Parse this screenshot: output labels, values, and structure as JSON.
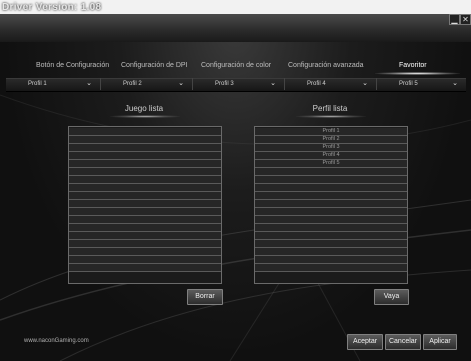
{
  "window": {
    "title": "Driver Version: 1.08"
  },
  "tabs": [
    {
      "label": "Botón de Configuración"
    },
    {
      "label": "Configuración de DPI"
    },
    {
      "label": "Configuración de color"
    },
    {
      "label": "Configuración avanzada"
    },
    {
      "label": "Favoritor"
    }
  ],
  "profiles": [
    {
      "label": "Profil 1"
    },
    {
      "label": "Profil 2"
    },
    {
      "label": "Profil 3"
    },
    {
      "label": "Profil 4"
    },
    {
      "label": "Profil 5"
    }
  ],
  "game_list": {
    "title": "Juego lista",
    "rows": [
      "",
      "",
      "",
      "",
      "",
      "",
      "",
      "",
      "",
      "",
      "",
      "",
      "",
      "",
      "",
      "",
      "",
      ""
    ],
    "button": "Borrar"
  },
  "profile_list": {
    "title": "Perfil lista",
    "rows": [
      "Profil 1",
      "Profil 2",
      "Profil 3",
      "Profil 4",
      "Profil 5",
      "",
      "",
      "",
      "",
      "",
      "",
      "",
      "",
      "",
      "",
      "",
      "",
      ""
    ],
    "button": "Vaya"
  },
  "footer": {
    "website": "www.naconGaming.com",
    "accept": "Aceptar",
    "cancel": "Cancelar",
    "apply": "Aplicar"
  }
}
